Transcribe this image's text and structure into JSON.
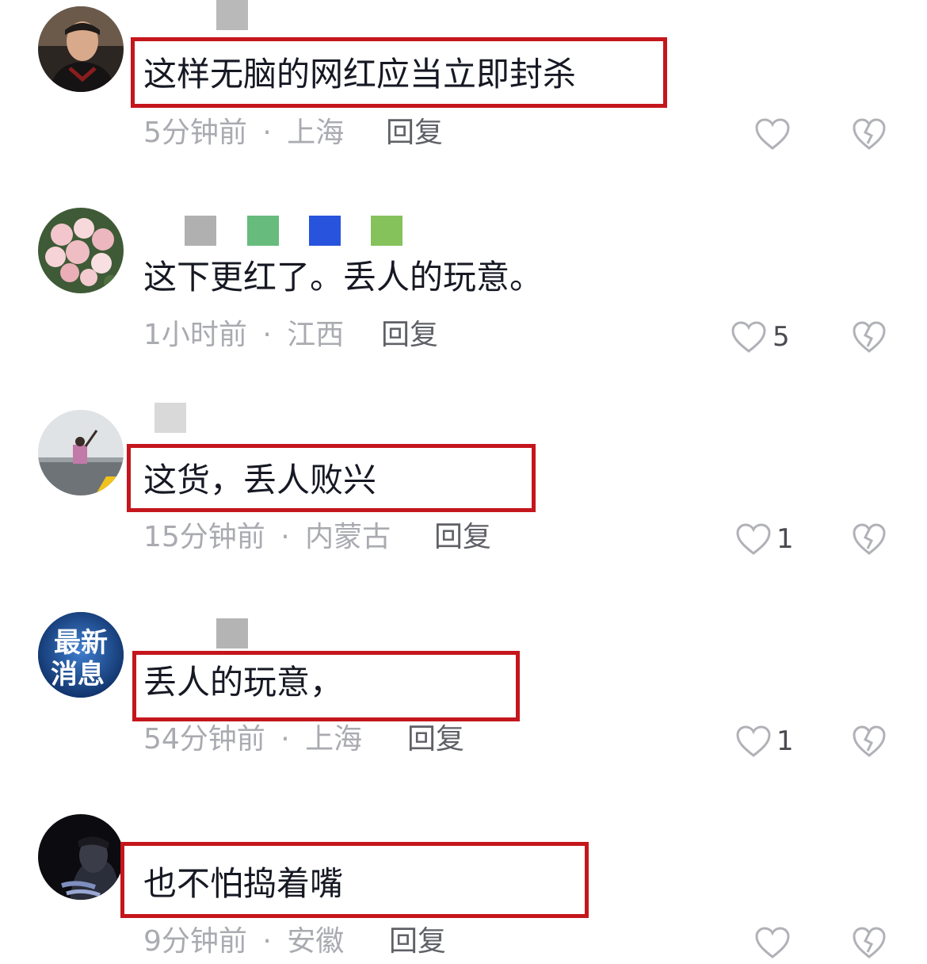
{
  "comments": [
    {
      "text": "这样无脑的网红应当立即封杀",
      "time": "5分钟前",
      "location": "上海",
      "reply": "回复",
      "likes": ""
    },
    {
      "text": "这下更红了。丢人的玩意。",
      "time": "1小时前",
      "location": "江西",
      "reply": "回复",
      "likes": "5"
    },
    {
      "text": "这货，丢人败兴",
      "time": "15分钟前",
      "location": "内蒙古",
      "reply": "回复",
      "likes": "1"
    },
    {
      "text": "丢人的玩意，",
      "time": "54分钟前",
      "location": "上海",
      "reply": "回复",
      "likes": "1"
    },
    {
      "text": "也不怕捣着嘴",
      "time": "9分钟前",
      "location": "安徽",
      "reply": "回复",
      "likes": ""
    }
  ],
  "avatar4_text": [
    "最新",
    "消息"
  ],
  "separator": "·",
  "colors": {
    "highlight_box": "#c4161c",
    "comment_text": "#161823",
    "meta_text": "#a9abb0",
    "reply_text": "#5f6167",
    "icon_stroke": "#b0b2b7"
  },
  "icons": {
    "like": "heart-outline-icon",
    "dislike": "broken-heart-icon"
  }
}
